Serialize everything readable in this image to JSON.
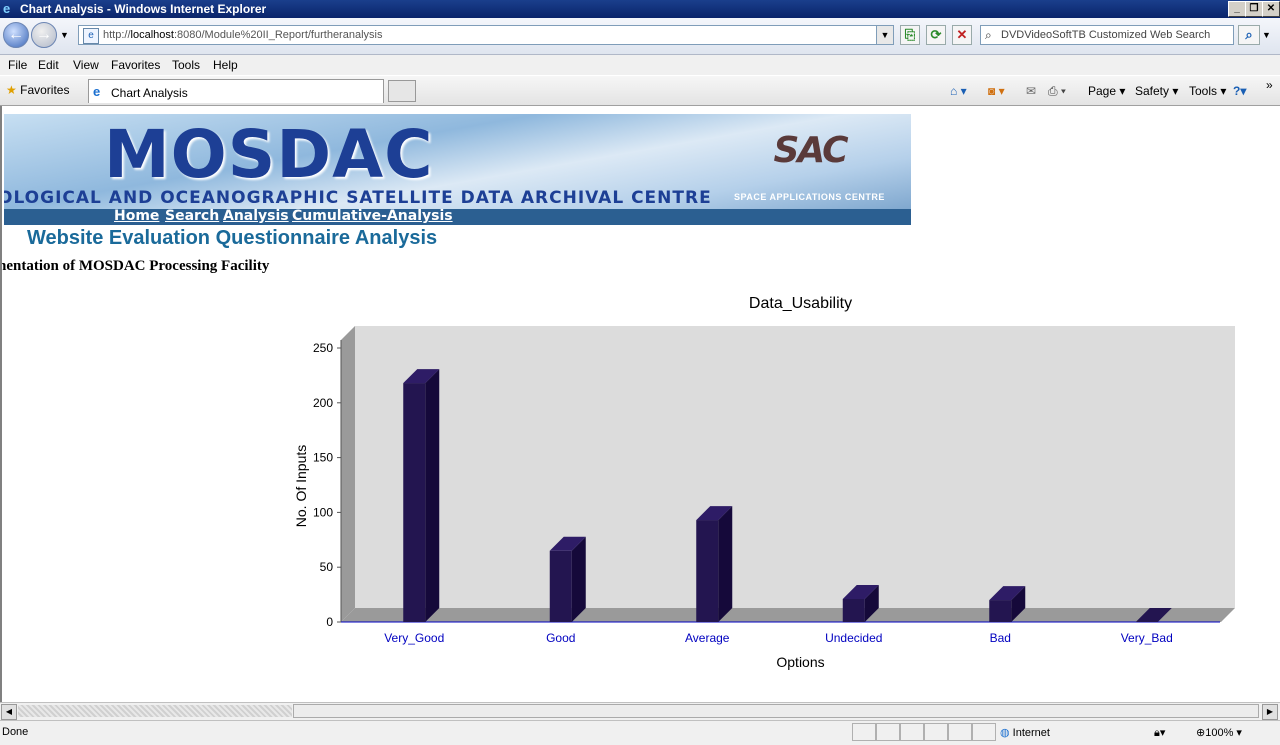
{
  "window": {
    "title": "Chart Analysis - Windows Internet Explorer"
  },
  "navbar": {
    "url_prefix": "http://",
    "url_host": "localhost",
    "url_rest": ":8080/Module%20II_Report/furtheranalysis",
    "search_placeholder": "DVDVideoSoftTB Customized Web Search"
  },
  "menu": {
    "file": "File",
    "edit": "Edit",
    "view": "View",
    "favorites": "Favorites",
    "tools": "Tools",
    "help": "Help"
  },
  "favbar": {
    "favorites_label": "Favorites",
    "tab_title": "Chart Analysis",
    "page_cmd": "Page",
    "safety_cmd": "Safety",
    "tools_cmd": "Tools"
  },
  "banner": {
    "logo": "MOSDAC",
    "subtitle": "OLOGICAL AND OCEANOGRAPHIC SATELLITE DATA ARCHIVAL CENTRE",
    "sac_logo": "SAC",
    "sac_subtitle": "SPACE APPLICATIONS CENTRE",
    "links": {
      "home": "Home",
      "search": "Search",
      "analysis": "Analysis",
      "cumulative": "Cumulative-Analysis"
    }
  },
  "page": {
    "heading": "Website Evaluation Questionnaire Analysis",
    "subheading": "nentation of MOSDAC Processing Facility"
  },
  "chart_data": {
    "type": "bar",
    "title": "Data_Usability",
    "xlabel": "Options",
    "ylabel": "No. Of Inputs",
    "categories": [
      "Very_Good",
      "Good",
      "Average",
      "Undecided",
      "Bad",
      "Very_Bad"
    ],
    "values": [
      218,
      65,
      93,
      21,
      20,
      0
    ],
    "ylim": [
      0,
      250
    ],
    "yticks": [
      0,
      50,
      100,
      150,
      200,
      250
    ],
    "bar_color": "#231550",
    "tick_label_color": "#0000c0",
    "plot_bg": "#dcdcdc"
  },
  "status": {
    "left": "Done",
    "zone": "Internet",
    "zoom": "100%"
  }
}
